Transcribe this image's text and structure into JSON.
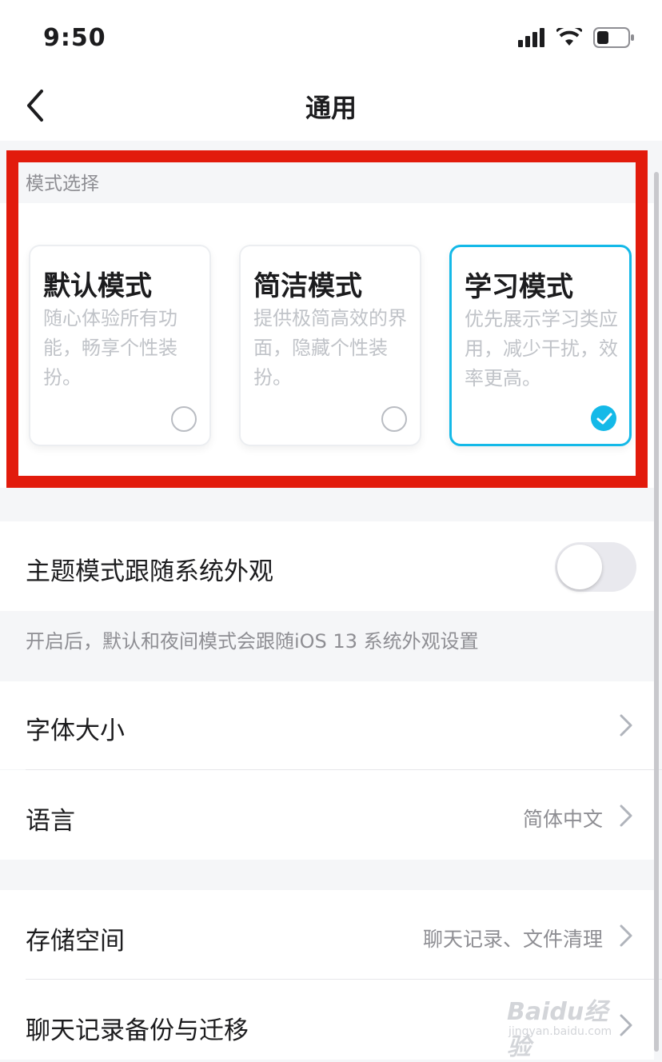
{
  "status_bar": {
    "time": "9:50"
  },
  "nav": {
    "title": "通用"
  },
  "mode_section": {
    "header": "模式选择",
    "modes": [
      {
        "title": "默认模式",
        "description": "随心体验所有功能，畅享个性装扮。",
        "selected": false
      },
      {
        "title": "简洁模式",
        "description": "提供极简高效的界面，隐藏个性装扮。",
        "selected": false
      },
      {
        "title": "学习模式",
        "description": "优先展示学习类应用，减少干扰，效率更高。",
        "selected": true
      }
    ]
  },
  "theme_follow": {
    "label": "主题模式跟随系统外观",
    "enabled": false
  },
  "hint": "开启后，默认和夜间模式会跟随iOS 13 系统外观设置",
  "rows": {
    "font_size": {
      "label": "字体大小"
    },
    "language": {
      "label": "语言",
      "value": "简体中文"
    },
    "storage": {
      "label": "存储空间",
      "value": "聊天记录、文件清理"
    },
    "backup": {
      "label": "聊天记录备份与迁移"
    }
  },
  "watermark": {
    "brand": "Baidu经验",
    "url": "jingyan.baidu.com"
  },
  "colors": {
    "accent": "#14b9e8",
    "highlight_frame": "#e21b0c"
  }
}
